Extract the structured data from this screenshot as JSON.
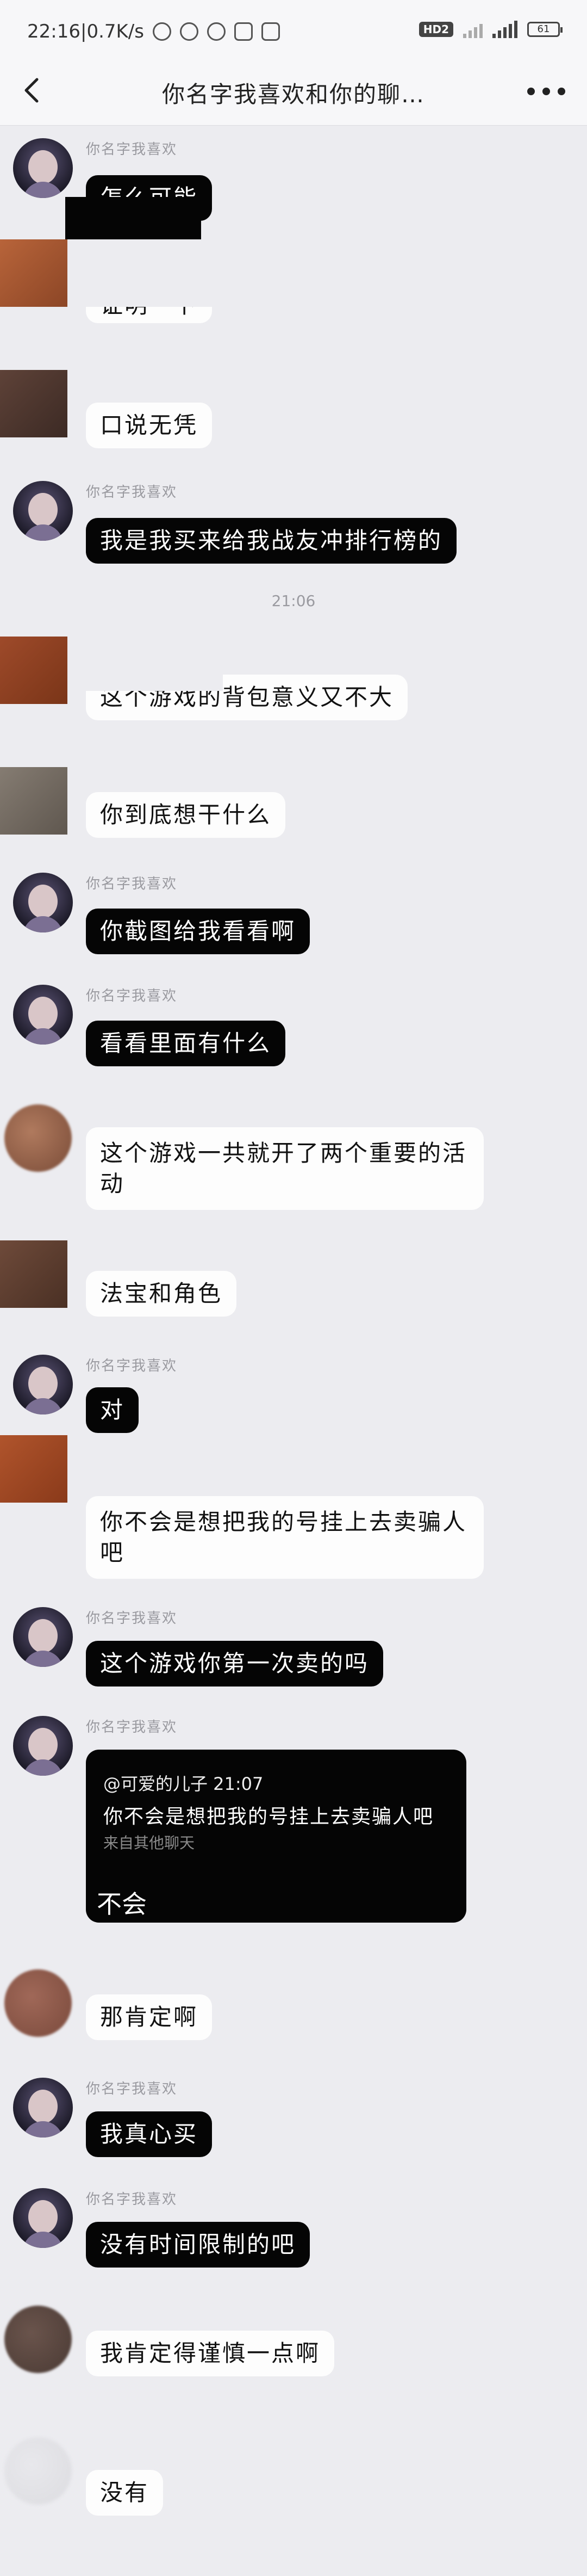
{
  "status": {
    "time_speed": "22:16|0.7K/s",
    "hd": "HD2",
    "battery": "61"
  },
  "header": {
    "title": "你名字我喜欢和你的聊…"
  },
  "time_separator": "21:06",
  "reply_card": {
    "quote_author": "@可爱的儿子 21:07",
    "quote_text": "你不会是想把我的号挂上去卖骗人吧",
    "quote_hint": "来自其他聊天",
    "reply": "不会"
  },
  "messages": [
    {
      "side": "left",
      "nick": "你名字我喜欢",
      "text": "怎么可能",
      "style": "black"
    },
    {
      "side": "left",
      "nick": "",
      "text": "证明一下",
      "style": "white"
    },
    {
      "side": "left",
      "nick": "",
      "text": "口说无凭",
      "style": "white"
    },
    {
      "side": "left",
      "nick": "你名字我喜欢",
      "text": "我是我买来给我战友冲排行榜的",
      "style": "black"
    },
    {
      "side": "left",
      "nick": "",
      "text": "这个游戏的背包意义又不大",
      "style": "white"
    },
    {
      "side": "left",
      "nick": "",
      "text": "你到底想干什么",
      "style": "white"
    },
    {
      "side": "left",
      "nick": "你名字我喜欢",
      "text": "你截图给我看看啊",
      "style": "black"
    },
    {
      "side": "left",
      "nick": "你名字我喜欢",
      "text": "看看里面有什么",
      "style": "black"
    },
    {
      "side": "left",
      "nick": "",
      "text": "这个游戏一共就开了两个重要的活动",
      "style": "white"
    },
    {
      "side": "left",
      "nick": "",
      "text": "法宝和角色",
      "style": "white"
    },
    {
      "side": "left",
      "nick": "你名字我喜欢",
      "text": "对",
      "style": "black"
    },
    {
      "side": "left",
      "nick": "",
      "text": "你不会是想把我的号挂上去卖骗人吧",
      "style": "white"
    },
    {
      "side": "left",
      "nick": "你名字我喜欢",
      "text": "这个游戏你第一次卖的吗",
      "style": "black"
    },
    {
      "side": "left",
      "nick": "你名字我喜欢",
      "text": "",
      "style": "card"
    },
    {
      "side": "left",
      "nick": "",
      "text": "那肯定啊",
      "style": "white"
    },
    {
      "side": "left",
      "nick": "你名字我喜欢",
      "text": "我真心买",
      "style": "black"
    },
    {
      "side": "left",
      "nick": "你名字我喜欢",
      "text": "没有时间限制的吧",
      "style": "black"
    },
    {
      "side": "left",
      "nick": "",
      "text": "我肯定得谨慎一点啊",
      "style": "white"
    },
    {
      "side": "left",
      "nick": "",
      "text": "没有",
      "style": "white"
    }
  ]
}
